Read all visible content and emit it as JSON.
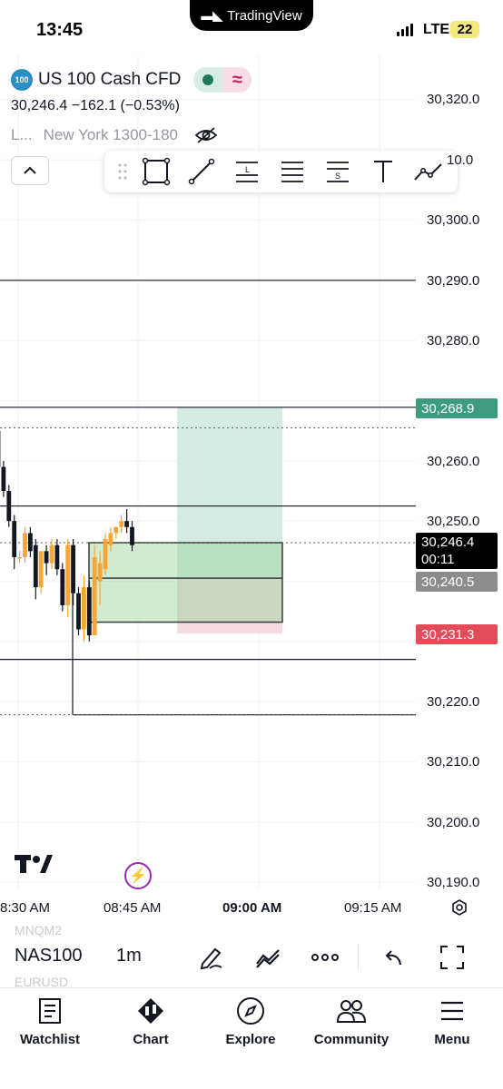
{
  "status_bar": {
    "time": "13:45",
    "brand": "TradingView",
    "network": "LTE",
    "battery": "22"
  },
  "symbol": {
    "badge": "100",
    "name": "US 100 Cash CFD",
    "price_line": "30,246.4  −162.1 (−0.53%)",
    "session_prefix": "L...",
    "session": "New York 1300-180"
  },
  "price_axis": {
    "labels": [
      "30,320.0",
      "10.0",
      "30,300.0",
      "30,290.0",
      "30,280.0",
      "30,260.0",
      "30,250.0",
      "30,220.0",
      "30,210.0",
      "30,200.0",
      "30,190.0"
    ],
    "tags": {
      "target": "30,268.9",
      "current": "30,246.4",
      "countdown": "00:11",
      "entry": "30,240.5",
      "stop": "30,231.3"
    },
    "colors": {
      "target": "#3f9b80",
      "current": "#000000",
      "entry": "#8c8c8c",
      "stop": "#e24b58"
    }
  },
  "time_axis": [
    "8:30 AM",
    "08:45 AM",
    "09:00 AM",
    "09:15 AM"
  ],
  "bottom_toolbar": {
    "ghost_top": "MNQM2",
    "symbol": "NAS100",
    "interval": "1m",
    "ghost_bottom": "EURUSD",
    "icons": [
      "pen-icon",
      "indicators-icon",
      "more-icon",
      "undo-icon",
      "fullscreen-icon"
    ]
  },
  "tabs": [
    {
      "label": "Watchlist",
      "icon": "watchlist-icon"
    },
    {
      "label": "Chart",
      "icon": "chart-icon"
    },
    {
      "label": "Explore",
      "icon": "compass-icon"
    },
    {
      "label": "Community",
      "icon": "community-icon"
    },
    {
      "label": "Menu",
      "icon": "hamburger-icon"
    }
  ],
  "chart_data": {
    "type": "candlestick",
    "up_color": "#f7a634",
    "down_color": "#131722",
    "candles": [
      {
        "o": 30265,
        "h": 30266,
        "l": 30258,
        "c": 30259
      },
      {
        "o": 30259,
        "h": 30260,
        "l": 30254,
        "c": 30255
      },
      {
        "o": 30255,
        "h": 30256,
        "l": 30249,
        "c": 30250
      },
      {
        "o": 30250,
        "h": 30251,
        "l": 30242,
        "c": 30244
      },
      {
        "o": 30244,
        "h": 30245,
        "l": 30243,
        "c": 30244
      },
      {
        "o": 30244,
        "h": 30249,
        "l": 30243,
        "c": 30248
      },
      {
        "o": 30248,
        "h": 30249,
        "l": 30244,
        "c": 30245
      },
      {
        "o": 30246,
        "h": 30247,
        "l": 30237,
        "c": 30239
      },
      {
        "o": 30239,
        "h": 30245,
        "l": 30238,
        "c": 30245
      },
      {
        "o": 30245,
        "h": 30246,
        "l": 30241,
        "c": 30243
      },
      {
        "o": 30243,
        "h": 30247,
        "l": 30242,
        "c": 30246
      },
      {
        "o": 30246,
        "h": 30247,
        "l": 30241,
        "c": 30242
      },
      {
        "o": 30242,
        "h": 30243,
        "l": 30235,
        "c": 30236
      },
      {
        "o": 30236,
        "h": 30247,
        "l": 30234,
        "c": 30246
      },
      {
        "o": 30246,
        "h": 30247,
        "l": 30236,
        "c": 30238
      },
      {
        "o": 30238,
        "h": 30239,
        "l": 30231,
        "c": 30232
      },
      {
        "o": 30232,
        "h": 30241,
        "l": 30230,
        "c": 30239
      },
      {
        "o": 30239,
        "h": 30240,
        "l": 30230,
        "c": 30231
      },
      {
        "o": 30231,
        "h": 30246,
        "l": 30231,
        "c": 30244
      },
      {
        "o": 30240,
        "h": 30245,
        "l": 30236,
        "c": 30243
      },
      {
        "o": 30242,
        "h": 30248,
        "l": 30241,
        "c": 30247
      },
      {
        "o": 30246,
        "h": 30249,
        "l": 30245,
        "c": 30248
      },
      {
        "o": 30248,
        "h": 30249,
        "l": 30247,
        "c": 30249
      },
      {
        "o": 30249,
        "h": 30251,
        "l": 30248,
        "c": 30250
      },
      {
        "o": 30250,
        "h": 30252,
        "l": 30248,
        "c": 30249
      },
      {
        "o": 30249,
        "h": 30250,
        "l": 30245,
        "c": 30246
      }
    ],
    "horizontal_lines": [
      30290.0,
      30268.9,
      30252.5,
      30227.0,
      30217.8
    ],
    "dotted_lines": [
      30265.5,
      30246.4,
      30217.8
    ],
    "position": {
      "entry": 30240.5,
      "target": 30268.9,
      "stop": 30231.3
    },
    "range_box": {
      "top": 30246.4,
      "bottom": 30233.2
    }
  }
}
